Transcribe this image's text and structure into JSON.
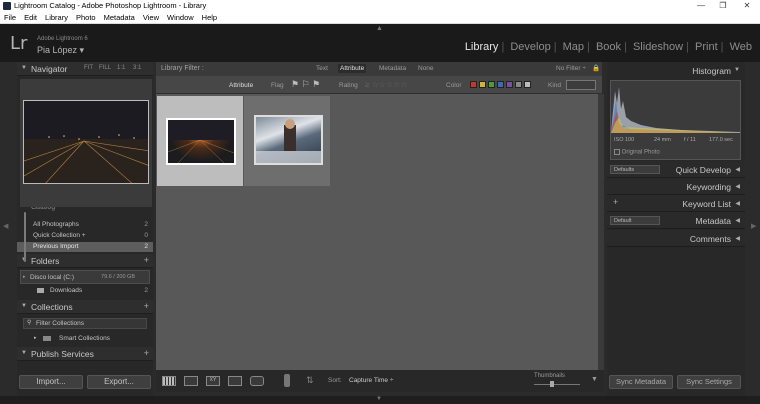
{
  "window": {
    "title": "Lightroom Catalog - Adobe Photoshop Lightroom - Library",
    "controls": [
      "—",
      "❐",
      "✕"
    ]
  },
  "menubar": [
    "File",
    "Edit",
    "Library",
    "Photo",
    "Metadata",
    "View",
    "Window",
    "Help"
  ],
  "header": {
    "logo": "Lr",
    "app_name": "Adobe Lightroom 6",
    "user": "Pia López ▾",
    "modules": [
      "Library",
      "Develop",
      "Map",
      "Book",
      "Slideshow",
      "Print",
      "Web"
    ],
    "active_module": "Library"
  },
  "left": {
    "navigator": {
      "title": "Navigator",
      "zoom": [
        "FIT",
        "FILL",
        "1:1",
        "3:1"
      ]
    },
    "catalog": {
      "title": "Catalog",
      "items": [
        {
          "label": "All Photographs",
          "count": "2"
        },
        {
          "label": "Quick Collection +",
          "count": "0"
        },
        {
          "label": "Previous Import",
          "count": "2"
        }
      ]
    },
    "folders": {
      "title": "Folders",
      "volume": "Disco local (C:)",
      "volume_size": "79.6 / 200 GB",
      "items": [
        {
          "label": "Downloads",
          "count": "2"
        }
      ]
    },
    "collections": {
      "title": "Collections",
      "filter": "Filter Collections",
      "items": [
        "Smart Collections"
      ]
    },
    "publish": {
      "title": "Publish Services"
    },
    "import_label": "Import...",
    "export_label": "Export..."
  },
  "filter": {
    "title": "Library Filter :",
    "tabs": [
      "Text",
      "Attribute",
      "Metadata",
      "None"
    ],
    "active_tab": "Attribute",
    "preset": "No Filter ÷",
    "attr_label": "Attribute",
    "flag_label": "Flag",
    "rating_label": "Rating",
    "color_label": "Color",
    "kind_label": "Kind",
    "colors": [
      "#c0392b",
      "#d4b52f",
      "#4f9a3c",
      "#3a6bb3",
      "#7b4fa0",
      "#888888",
      "#bbbbbb"
    ]
  },
  "grid": {
    "cells": [
      {
        "selected": true,
        "subject": "night-city-long-exposure"
      },
      {
        "selected": false,
        "subject": "person-in-winter-scene"
      }
    ]
  },
  "toolbar": {
    "sort_label": "Sort:",
    "sort_value": "Capture Time ÷",
    "thumbnails_label": "Thumbnails"
  },
  "right": {
    "histogram": {
      "title": "Histogram",
      "iso": "ISO 100",
      "focal": "24 mm",
      "aperture": "f / 11",
      "shutter": "177.0 sec",
      "original_photo": "Original Photo"
    },
    "quick_develop": {
      "title": "Quick Develop",
      "preset": "Defaults"
    },
    "keywording": "Keywording",
    "keyword_list": "Keyword List",
    "metadata": {
      "title": "Metadata",
      "preset": "Default"
    },
    "comments": "Comments",
    "sync_metadata": "Sync Metadata",
    "sync_settings": "Sync Settings"
  }
}
